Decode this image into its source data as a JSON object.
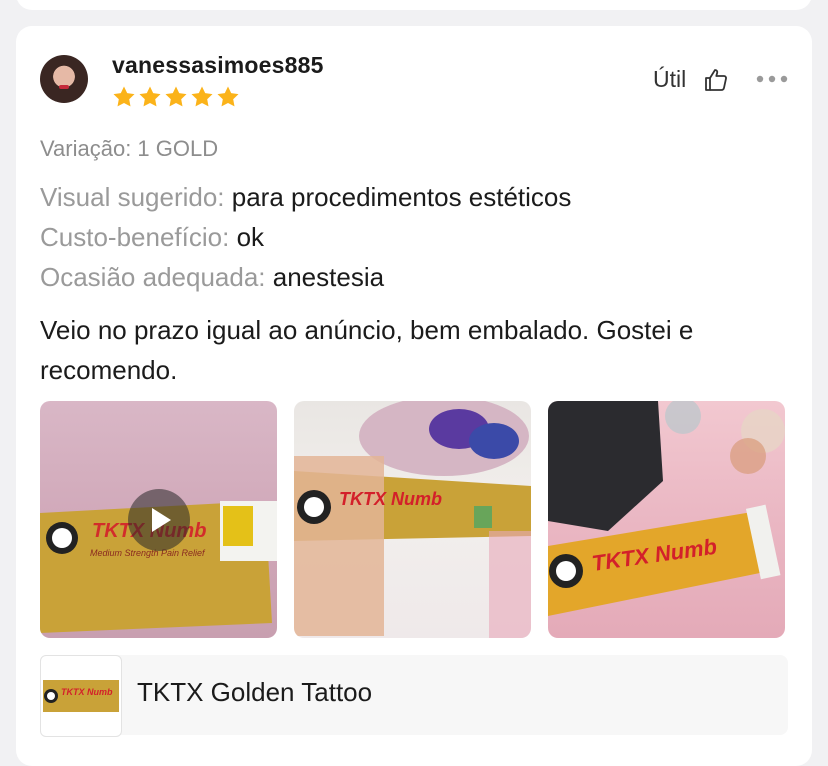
{
  "review": {
    "username": "vanessasimoes885",
    "rating": 5,
    "useful_label": "Útil",
    "variation": "Variação: 1 GOLD",
    "attributes": [
      {
        "key": "Visual sugerido:",
        "value": "para procedimentos estéticos"
      },
      {
        "key": "Custo-benefício:",
        "value": "ok"
      },
      {
        "key": "Ocasião adequada:",
        "value": "anestesia"
      }
    ],
    "text": "Veio no prazo igual ao anúncio, bem embalado. Gostei e recomendo.",
    "media": [
      {
        "kind": "video",
        "caption_text": "TKTX Numb"
      },
      {
        "kind": "image",
        "caption_text": "TKTX Numb"
      },
      {
        "kind": "image",
        "caption_text": "TKTX Numb"
      }
    ]
  },
  "product": {
    "name": "TKTX Golden Tattoo",
    "thumb_text": "TKTX Numb"
  },
  "colors": {
    "star": "#fbb31a",
    "tube_gold": "#c9a238",
    "brand_red": "#d3202a"
  },
  "icons": {
    "useful": "thumbs-up-icon",
    "more": "more-dots-icon",
    "play": "play-icon"
  }
}
